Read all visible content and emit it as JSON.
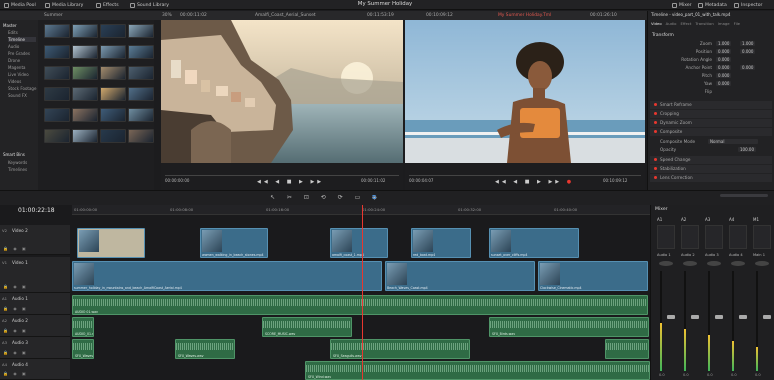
{
  "topbar": {
    "media_pool": "Media Pool",
    "media_library": "Media Library",
    "effects": "Effects",
    "sound_library": "Sound Library",
    "project_title": "My Summer Holiday",
    "mixer": "Mixer",
    "metadata": "Metadata",
    "inspector": "Inspector"
  },
  "bar2": {
    "bin": "Summer",
    "zoom": "30%",
    "src_tc": "00:00:11:02",
    "src_clip": "Amalfi_Coast_Aerial_Sunset",
    "src_tc2": "00:11:53:19",
    "rec_tc": "00:10:09:12",
    "rec_name": "My Summer Holiday.Tml",
    "rec_tc2": "00:01:26:10",
    "insp_clip": "Timeline - video_part_01_with_talk.mp4"
  },
  "sidebar": {
    "items": [
      "Master",
      "Edits",
      "Timeline",
      "Audio",
      "Pre Grades",
      "Drone",
      "Magenta",
      "Live Video",
      "Videos",
      "Stock Footage",
      "Sound FX"
    ],
    "smart_bins": "Smart Bins",
    "smart_items": [
      "Keywords",
      "Timelines"
    ]
  },
  "media_thumbs": [
    "#5d7990",
    "#7e9fb5",
    "#2a3f55",
    "#8ba7b9",
    "#3d5a74",
    "#b2c3cf",
    "#7c9ab0",
    "#5b7d96",
    "#404d57",
    "#6e8e63",
    "#a38b6c",
    "#4d5f6e",
    "#2e3a44",
    "#5c6a74",
    "#d0a86c",
    "#516e88",
    "#334455",
    "#8a7260",
    "#3f5c78",
    "#6f8da0",
    "#4b4a3f",
    "#9bb0c0",
    "#27394b",
    "#7a6656"
  ],
  "viewer_src": {
    "tc_left": "00:00:00:00",
    "tc_right": "00:00:11:02"
  },
  "viewer_rec": {
    "tc_left": "00:00:04:07",
    "tc_right": "00:10:09:12"
  },
  "inspector": {
    "tabs": [
      "Video",
      "Audio",
      "Effect",
      "Transition",
      "Image",
      "File"
    ],
    "transform": "Transform",
    "rows": [
      {
        "label": "Zoom",
        "x": "1.000",
        "y": "1.000"
      },
      {
        "label": "Position",
        "x": "0.000",
        "y": "0.000"
      },
      {
        "label": "Rotation Angle",
        "x": "0.000",
        "y": ""
      },
      {
        "label": "Anchor Point",
        "x": "0.000",
        "y": "0.000"
      },
      {
        "label": "Pitch",
        "x": "0.000",
        "y": ""
      },
      {
        "label": "Yaw",
        "x": "0.000",
        "y": ""
      },
      {
        "label": "Flip",
        "x": "",
        "y": ""
      }
    ],
    "sections": [
      "Smart Reframe",
      "Cropping",
      "Dynamic Zoom",
      "Composite"
    ],
    "composite_mode_label": "Composite Mode",
    "composite_mode": "Normal",
    "opacity_label": "Opacity",
    "opacity": "100.00",
    "more": [
      "Speed Change",
      "Stabilization",
      "Lens Correction"
    ]
  },
  "timeline": {
    "timecode": "01:00:22:18",
    "ruler": [
      "01:00:00:00",
      "01:00:08:00",
      "01:00:16:00",
      "01:00:24:00",
      "01:00:32:00",
      "01:00:40:00",
      "01:00:48:00"
    ],
    "tracks": [
      {
        "tag": "V2",
        "name": "Video 2"
      },
      {
        "tag": "V1",
        "name": "Video 1"
      },
      {
        "tag": "A1",
        "name": "Audio 1"
      },
      {
        "tag": "A2",
        "name": "Audio 2"
      },
      {
        "tag": "A3",
        "name": "Audio 3"
      },
      {
        "tag": "A4",
        "name": "Audio 4"
      }
    ],
    "v2_clips": [
      "",
      "women_walking_in_beach_stones.mp4",
      "amalfi_coast_1.mp4",
      "red_boat.mp4",
      "sunset_over_cliffs.mp4"
    ],
    "v1_caption_a": "summer_holiday_in_mountains_and_beach_AmalfiCoast_Aerial.mp4",
    "v1_caption_b": "Beach_Waves_Coast.mp4",
    "v1_caption_c": "Clockwise_Cinematic.mp4",
    "a1_caption_a": "AUDIO 01.wav",
    "a2_caption_a": "AUDIO_01.mp3",
    "a2_caption_b": "SCORE_MUSIC.wav",
    "a2_caption_c": "SFX_Birds.wav",
    "a3_caption_a": "SFX_Waves.wav",
    "a3_caption_b": "SFX_Seagulls.wav",
    "a4_caption_a": "SFX_Wind.wav",
    "a4_caption_b": "Music_Track.wav"
  },
  "mixer": {
    "title": "Mixer",
    "channels": [
      "A1",
      "A2",
      "A3",
      "A4",
      "M1"
    ],
    "channel_names": [
      "Audio 1",
      "Audio 2",
      "Audio 3",
      "Audio 4",
      "Main 1"
    ],
    "values": [
      "0.0",
      "0.0",
      "0.0",
      "0.0",
      "0.0"
    ]
  }
}
